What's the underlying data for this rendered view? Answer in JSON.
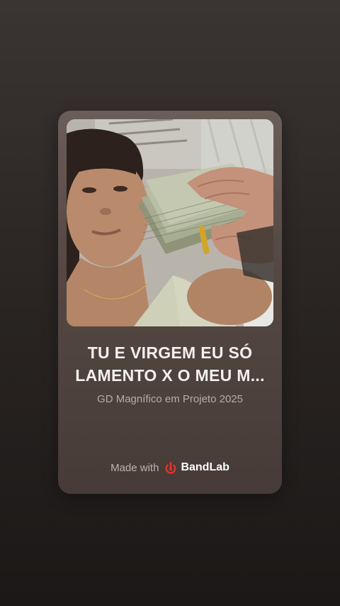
{
  "track": {
    "title_line1": "TU E VIRGEM EU SÓ",
    "title_line2": "LAMENTO X O MEU M...",
    "subtitle": "GD Magnífico em Projeto 2025"
  },
  "footer": {
    "made_with": "Made with",
    "brand": "BandLab",
    "brand_icon": "bandlab-logo-icon",
    "brand_color": "#e8322c"
  },
  "colors": {
    "background_top": "#3a3432",
    "background_bottom": "#1b1817",
    "card": "#574a45",
    "title_text": "#f4f0ee",
    "subtitle_text": "#b7aca6"
  }
}
